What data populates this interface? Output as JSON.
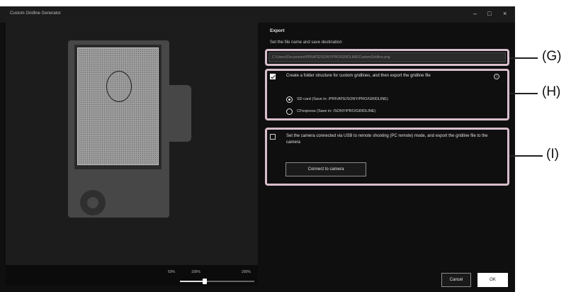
{
  "window": {
    "title": "Custom Gridline Generator",
    "controls": {
      "minimize": "–",
      "maximize": "□",
      "close": "×"
    }
  },
  "preview": {
    "zoom_labels": [
      "50%",
      "100%",
      "200%"
    ],
    "zoom_fraction": 0.33
  },
  "export": {
    "heading": "Export",
    "subheading": "Set the file name and save destination",
    "path_value": "C:\\Users\\Documents\\PRIVATE\\SONY\\PRO\\GRIDLINE\\CustomGridline.png",
    "folder_option": {
      "checked": true,
      "label": "Create a folder structure for custom gridlines, and then export the gridline file",
      "info_icon": "info-icon"
    },
    "radios": [
      {
        "label": "SD card (Save in: /PRIVATE/SONY/PRO/GRIDLINE)",
        "selected": true
      },
      {
        "label": "CFexpress (Save in: /SONY/PRO/GRIDLINE)",
        "selected": false
      }
    ],
    "camera_option": {
      "checked": false,
      "label": "Set the camera connected via USB to remote shooting (PC remote) mode, and export the gridline file to the camera",
      "button": "Connect to camera"
    }
  },
  "buttons": {
    "cancel": "Cancel",
    "ok": "OK"
  },
  "callouts": [
    "(G)",
    "(H)",
    "(I)"
  ],
  "colors": {
    "highlight": "#d8bdcb",
    "window_bg": "#0f0f0f"
  }
}
